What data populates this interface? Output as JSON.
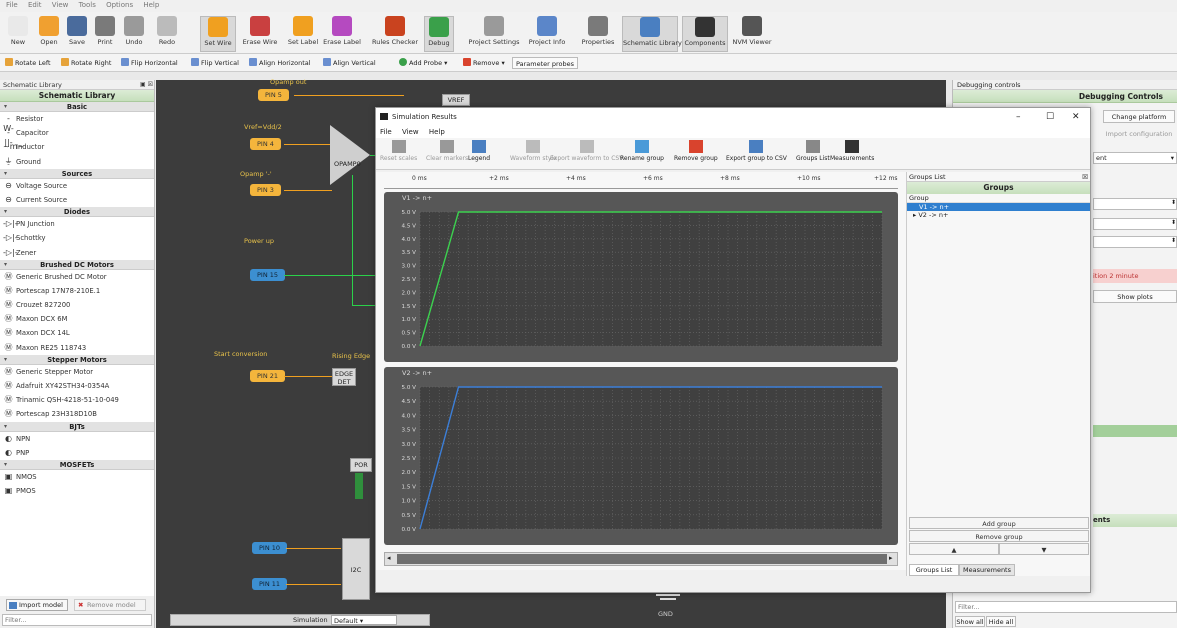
{
  "menubar": [
    "File",
    "Edit",
    "View",
    "Tools",
    "Options",
    "Help"
  ],
  "toolbar": [
    {
      "label": "New",
      "icon": "new-file-icon"
    },
    {
      "label": "Open",
      "icon": "folder-open-icon"
    },
    {
      "label": "Save",
      "icon": "save-icon"
    },
    {
      "label": "Print",
      "icon": "print-icon"
    },
    {
      "label": "Undo",
      "icon": "undo-icon"
    },
    {
      "label": "Redo",
      "icon": "redo-icon"
    },
    {
      "label": "Set Wire",
      "icon": "wire-icon"
    },
    {
      "label": "Erase Wire",
      "icon": "erase-wire-icon"
    },
    {
      "label": "Set Label",
      "icon": "label-icon"
    },
    {
      "label": "Erase Label",
      "icon": "erase-label-icon"
    },
    {
      "label": "Rules Checker",
      "icon": "bug-icon"
    },
    {
      "label": "Debug",
      "icon": "debug-icon"
    },
    {
      "label": "Project Settings",
      "icon": "settings-icon"
    },
    {
      "label": "Project Info",
      "icon": "info-icon"
    },
    {
      "label": "Properties",
      "icon": "properties-icon"
    },
    {
      "label": "Schematic Library",
      "icon": "library-icon"
    },
    {
      "label": "Components",
      "icon": "chip-icon"
    },
    {
      "label": "NVM Viewer",
      "icon": "grid-icon"
    }
  ],
  "toolbar2": [
    "Rotate Left",
    "Rotate Right",
    "Flip Horizontal",
    "Flip Vertical",
    "Align Horizontal",
    "Align Vertical",
    "Add Probe",
    "Remove",
    "Parameter probes"
  ],
  "library": {
    "header": "Schematic Library",
    "title": "Schematic Library",
    "sections": [
      {
        "name": "Basic",
        "items": [
          "Resistor",
          "Capacitor",
          "Inductor",
          "Ground"
        ]
      },
      {
        "name": "Sources",
        "items": [
          "Voltage Source",
          "Current Source"
        ]
      },
      {
        "name": "Diodes",
        "items": [
          "PN Junction",
          "Schottky",
          "Zener"
        ]
      },
      {
        "name": "Brushed DC Motors",
        "items": [
          "Generic Brushed DC Motor",
          "Portescap 17N78-210E.1",
          "Crouzet 827200",
          "Maxon DCX 6M",
          "Maxon DCX 14L",
          "Maxon RE25 118743"
        ]
      },
      {
        "name": "Stepper Motors",
        "items": [
          "Generic Stepper Motor",
          "Adafruit XY42STH34-0354A",
          "Trinamic QSH-4218-51-10-049",
          "Portescap 23H318D10B"
        ]
      },
      {
        "name": "BJTs",
        "items": [
          "NPN",
          "PNP"
        ]
      },
      {
        "name": "MOSFETs",
        "items": [
          "NMOS",
          "PMOS"
        ]
      }
    ],
    "import_label": "Import model",
    "remove_label": "Remove model",
    "filter_placeholder": "Filter..."
  },
  "schematic": {
    "pins": [
      "PIN 5",
      "PIN 4",
      "PIN 3",
      "PIN 15",
      "PIN 21",
      "PIN 10",
      "PIN 11"
    ],
    "labels": [
      "Opamp out",
      "Vref=Vdd/2",
      "Opamp '-'",
      "Power up",
      "Start conversion",
      "Rising Edge"
    ],
    "blocks": [
      "VREF",
      "OPAMP0",
      "EDGE DET",
      "POR",
      "I2C"
    ],
    "gnd": "GND"
  },
  "sim": {
    "title": "Simulation Results",
    "menu": [
      "File",
      "View",
      "Help"
    ],
    "toolbar": [
      {
        "label": "Reset scales",
        "enabled": false
      },
      {
        "label": "Clear markers",
        "enabled": false
      },
      {
        "label": "Legend",
        "enabled": true
      },
      {
        "label": "Waveform style",
        "enabled": false
      },
      {
        "label": "Export waveform to CSV",
        "enabled": false
      },
      {
        "label": "Rename group",
        "enabled": true
      },
      {
        "label": "Remove group",
        "enabled": true
      },
      {
        "label": "Export group to CSV",
        "enabled": true
      },
      {
        "label": "Groups List",
        "enabled": true
      },
      {
        "label": "Measurements",
        "enabled": true
      }
    ],
    "groups_header": "Groups List",
    "groups_title": "Groups",
    "group_col": "Group",
    "groups": [
      "V1 -> n+",
      "V2 -> n+"
    ],
    "add_group": "Add group",
    "remove_group": "Remove group",
    "tabs": [
      "Groups List",
      "Measurements"
    ]
  },
  "chart_data": [
    {
      "type": "line",
      "title": "V1 -> n+",
      "x_ticks": [
        "0 ms",
        "+2 ms",
        "+4 ms",
        "+6 ms",
        "+8 ms",
        "+10 ms",
        "+12 ms"
      ],
      "y_ticks": [
        "0.0 V",
        "0.5 V",
        "1.0 V",
        "1.5 V",
        "2.0 V",
        "2.5 V",
        "3.0 V",
        "3.5 V",
        "4.0 V",
        "4.5 V",
        "5.0 V"
      ],
      "ylim": [
        0,
        5
      ],
      "xlim": [
        0,
        12
      ],
      "color": "#3cd14f",
      "x": [
        0,
        1,
        12
      ],
      "y": [
        0,
        5,
        5
      ]
    },
    {
      "type": "line",
      "title": "V2 -> n+",
      "y_ticks": [
        "0.0 V",
        "0.5 V",
        "1.0 V",
        "1.5 V",
        "2.0 V",
        "2.5 V",
        "3.0 V",
        "3.5 V",
        "4.0 V",
        "4.5 V",
        "5.0 V"
      ],
      "ylim": [
        0,
        5
      ],
      "xlim": [
        0,
        12
      ],
      "color": "#3c7fd8",
      "x": [
        0,
        1,
        12
      ],
      "y": [
        0,
        5,
        5
      ]
    }
  ],
  "right_panel": {
    "header": "Debugging controls",
    "title": "Debugging Controls",
    "change_platform": "Change platform",
    "import_config": "Import configuration",
    "dropdown": "ent",
    "warning": "ition 2 minute",
    "show_plots": "Show plots",
    "ents": "ents",
    "filter_placeholder": "Filter...",
    "show_all": "Show all",
    "hide_all": "Hide all"
  },
  "status": {
    "mode": "Simulation",
    "config": "Default"
  }
}
